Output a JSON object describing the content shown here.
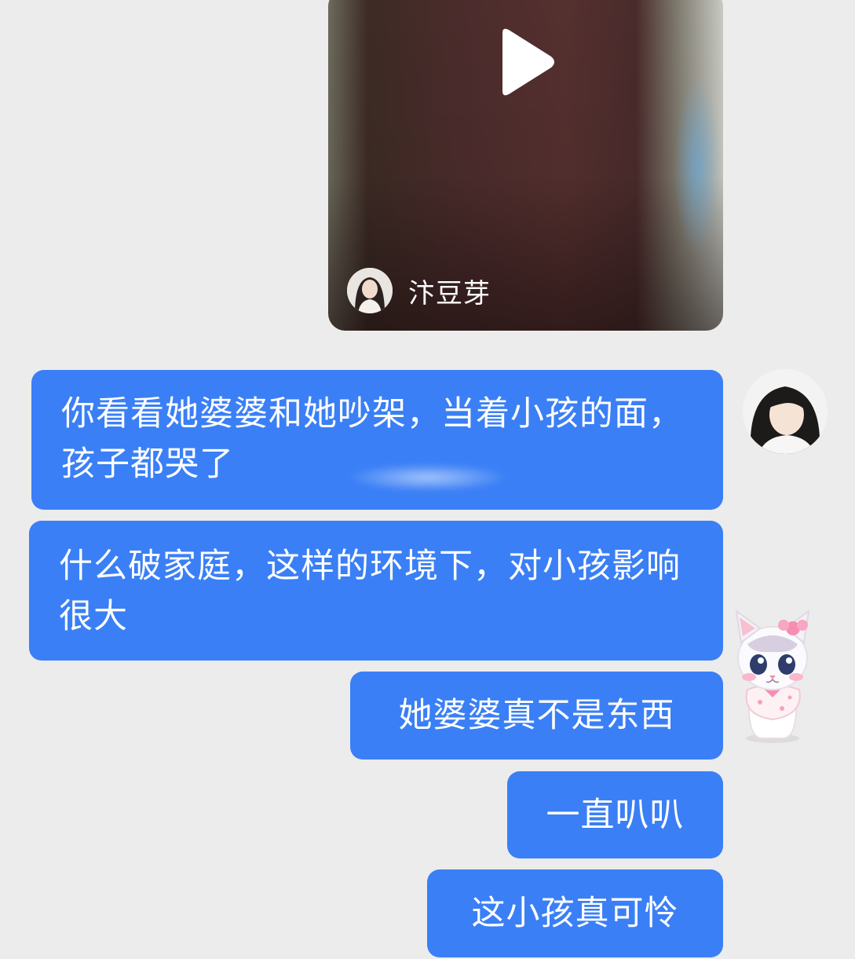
{
  "video_card": {
    "author_name": "汴豆芽",
    "play_icon": "play-icon"
  },
  "messages": [
    {
      "id": "m1",
      "text": "你看看她婆婆和她吵架，当着小孩的面，孩子都哭了"
    },
    {
      "id": "m2",
      "text": "什么破家庭，这样的环境下，对小孩影响很大"
    },
    {
      "id": "m3",
      "text": "她婆婆真不是东西"
    },
    {
      "id": "m4",
      "text": "一直叭叭"
    },
    {
      "id": "m5",
      "text": "这小孩真可怜"
    }
  ],
  "colors": {
    "background": "#ececec",
    "bubble": "#3a7ff6",
    "bubble_text": "#ffffff"
  }
}
